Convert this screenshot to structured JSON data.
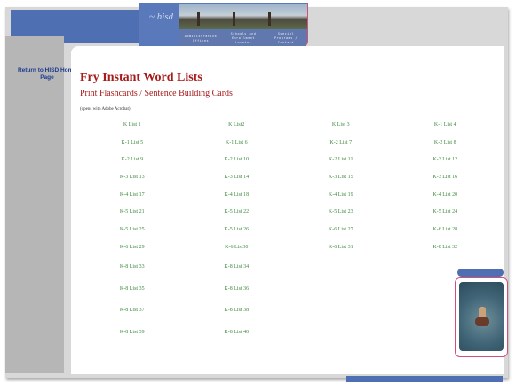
{
  "header": {
    "logo_text": "~ hisd",
    "links": [
      "Administrative Offices",
      "Schools and Enrollment Locator",
      "Special Programs / Contact"
    ]
  },
  "sidebar": {
    "return_link": "Return to HISD Home Page"
  },
  "main": {
    "title": "Fry Instant Word Lists",
    "subtitle": "Print Flashcards / Sentence Building Cards",
    "note": "(opens with Adobe Acrobat)"
  },
  "word_lists": [
    [
      "K List 1",
      "K List2",
      "K List 3",
      "K-1 List 4"
    ],
    [
      "K-1 List 5",
      "K-1 List 6",
      "K-2 List 7",
      "K-2 List 8"
    ],
    [
      "K-2 List 9",
      "K-2 List 10",
      "K-2 List 11",
      "K-3 List 12"
    ],
    [
      "K-3 List 13",
      "K-3 List 14",
      "K-3 List 15",
      "K-3 List 16"
    ],
    [
      "K-4 List 17",
      "K-4 List 18",
      "K-4 List 19",
      "K-4 List 20"
    ],
    [
      "K-5 List 21",
      "K-5 List 22",
      "K-5 List 23",
      "K-5 List 24"
    ],
    [
      "K-5 List 25",
      "K-5 List 26",
      "K-6 List 27",
      "K-6 List 28"
    ],
    [
      "K-6 List 29",
      "K-6 List30",
      "K-6 List 31",
      "K-8 List 32"
    ],
    [
      "K-8 List 33",
      "K-8 List 34",
      "",
      ""
    ],
    [
      "K-8 List 35",
      "K-8 List 36",
      "",
      ""
    ],
    [
      "K-8 List 37",
      "K-8 List 38",
      "",
      ""
    ],
    [
      "K-8 List 39",
      "K-8 List 40",
      "",
      ""
    ]
  ],
  "colors": {
    "accent_blue": "#4f6fb3",
    "title_red": "#a61b1b",
    "link_green": "#3e8a3e",
    "frame_pink": "#d0507a"
  }
}
